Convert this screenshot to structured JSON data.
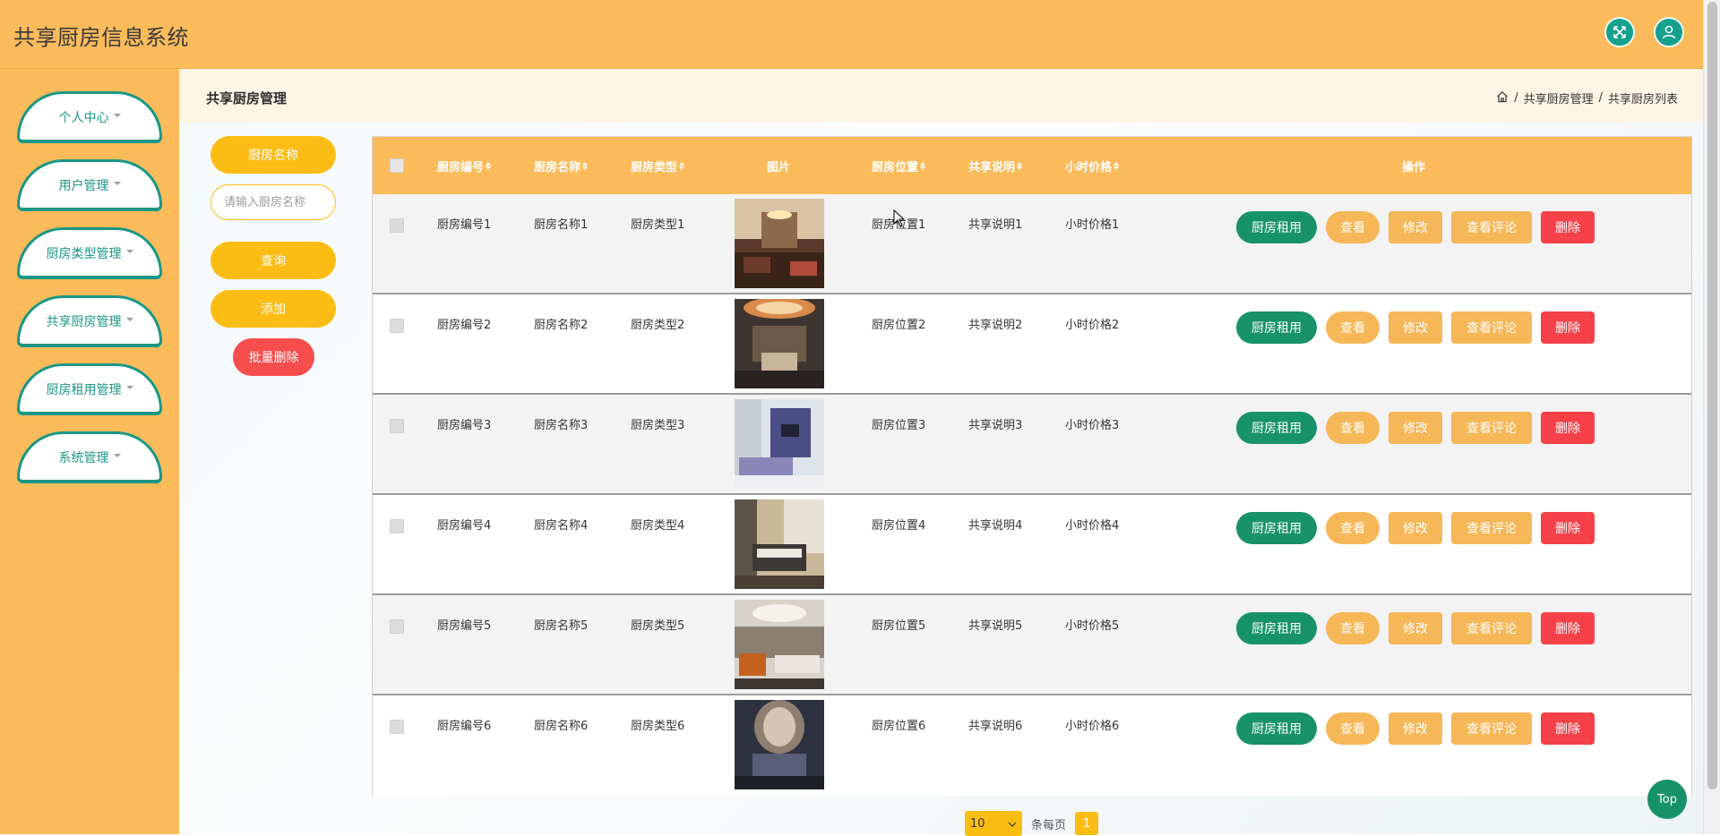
{
  "app": {
    "title": "共享厨房信息系统"
  },
  "colors": {
    "header": "#fbbb5b",
    "teal": "#1a9786",
    "yellow": "#fbbd13",
    "green": "#189268",
    "red": "#f64148"
  },
  "header": {
    "fullscreen_icon": "fullscreen-icon",
    "user_icon": "user-icon"
  },
  "sidebar": {
    "items": [
      {
        "label": "个人中心"
      },
      {
        "label": "用户管理"
      },
      {
        "label": "厨房类型管理"
      },
      {
        "label": "共享厨房管理"
      },
      {
        "label": "厨房租用管理"
      },
      {
        "label": "系统管理"
      }
    ]
  },
  "breadcrumb": {
    "page_title": "共享厨房管理",
    "items": [
      "共享厨房管理",
      "共享厨房列表"
    ],
    "separator": "/"
  },
  "search": {
    "label": "厨房名称",
    "placeholder": "请输入厨房名称",
    "query_button": "查询",
    "add_button": "添加",
    "batch_delete_button": "批量删除"
  },
  "table": {
    "columns": [
      "厨房编号",
      "厨房名称",
      "厨房类型",
      "图片",
      "厨房位置",
      "共享说明",
      "小时价格",
      "操作"
    ],
    "rows": [
      {
        "id": "厨房编号1",
        "name": "厨房名称1",
        "type": "厨房类型1",
        "location": "厨房位置1",
        "desc": "共享说明1",
        "price": "小时价格1"
      },
      {
        "id": "厨房编号2",
        "name": "厨房名称2",
        "type": "厨房类型2",
        "location": "厨房位置2",
        "desc": "共享说明2",
        "price": "小时价格2"
      },
      {
        "id": "厨房编号3",
        "name": "厨房名称3",
        "type": "厨房类型3",
        "location": "厨房位置3",
        "desc": "共享说明3",
        "price": "小时价格3"
      },
      {
        "id": "厨房编号4",
        "name": "厨房名称4",
        "type": "厨房类型4",
        "location": "厨房位置4",
        "desc": "共享说明4",
        "price": "小时价格4"
      },
      {
        "id": "厨房编号5",
        "name": "厨房名称5",
        "type": "厨房类型5",
        "location": "厨房位置5",
        "desc": "共享说明5",
        "price": "小时价格5"
      },
      {
        "id": "厨房编号6",
        "name": "厨房名称6",
        "type": "厨房类型6",
        "location": "厨房位置6",
        "desc": "共享说明6",
        "price": "小时价格6"
      }
    ],
    "actions": {
      "rent": "厨房租用",
      "view": "查看",
      "edit": "修改",
      "review": "查看评论",
      "delete": "删除"
    }
  },
  "pager": {
    "page_size": "10",
    "per_page_label": "条每页",
    "current_page": "1"
  },
  "top_button": "Top"
}
